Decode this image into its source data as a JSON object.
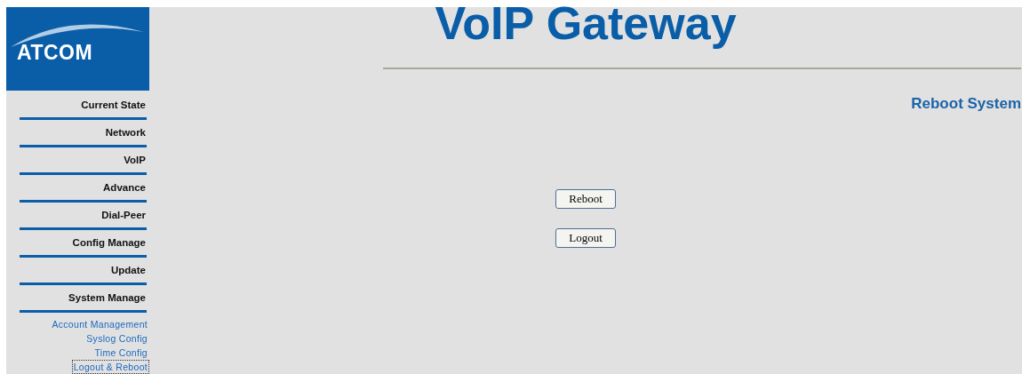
{
  "logo": {
    "text": "ATCOM"
  },
  "title": "VoIP Gateway",
  "menu": [
    {
      "label": "Current State"
    },
    {
      "label": "Network"
    },
    {
      "label": "VoIP"
    },
    {
      "label": "Advance"
    },
    {
      "label": "Dial-Peer"
    },
    {
      "label": "Config Manage"
    },
    {
      "label": "Update"
    },
    {
      "label": "System Manage"
    }
  ],
  "submenu": [
    {
      "label": "Account Management",
      "selected": false
    },
    {
      "label": "Syslog Config",
      "selected": false
    },
    {
      "label": "Time Config",
      "selected": false
    },
    {
      "label": "Logout & Reboot",
      "selected": true
    }
  ],
  "section_title": "Reboot System",
  "buttons": [
    "Reboot",
    "Logout"
  ]
}
